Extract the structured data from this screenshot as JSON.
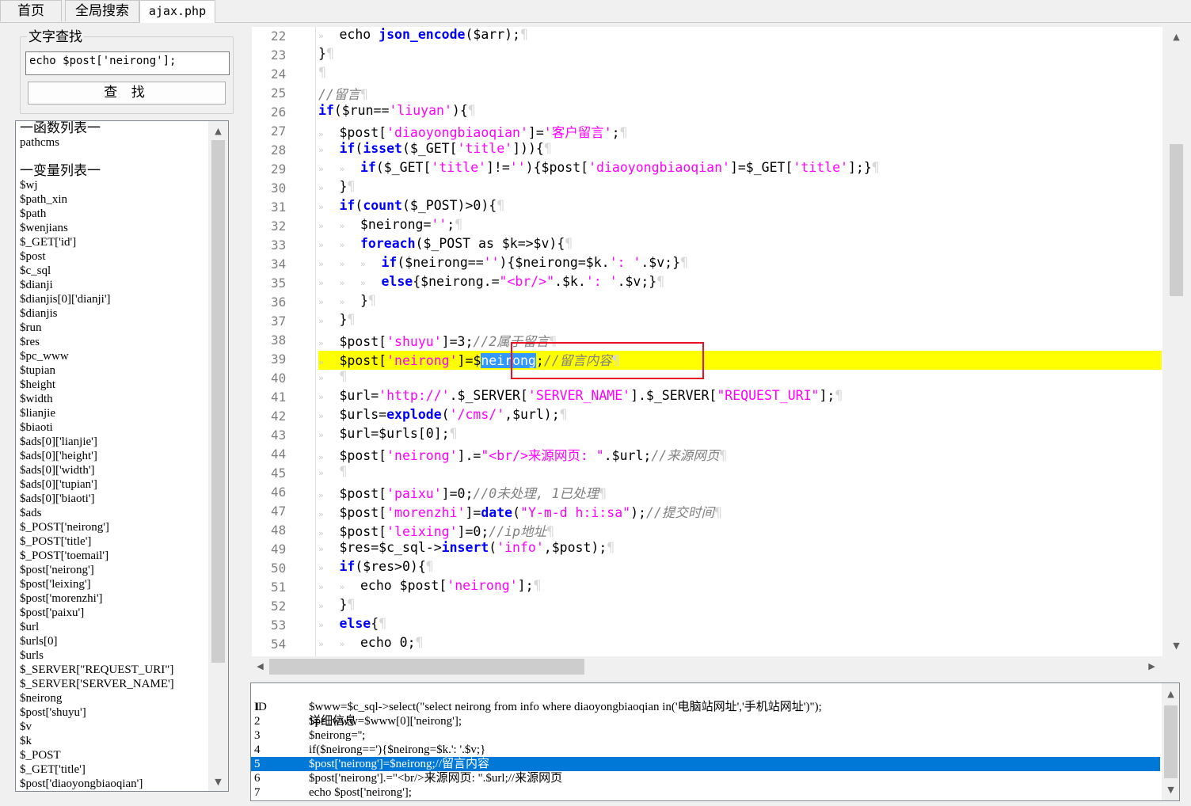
{
  "tabs": [
    "首页",
    "全局搜索",
    "ajax.php"
  ],
  "search": {
    "legend": "文字查找",
    "value": "echo $post['neirong'];",
    "button": "查 找"
  },
  "symbols": {
    "functions_header": "一函数列表一",
    "functions": [
      "pathcms"
    ],
    "variables_header": "一变量列表一",
    "variables": [
      "$wj",
      "$path_xin",
      "$path",
      "$wenjians",
      "$_GET['id']",
      "$post",
      "$c_sql",
      "$dianji",
      "$dianjis[0]['dianji']",
      "$dianjis",
      "$run",
      "$res",
      "$pc_www",
      "$tupian",
      "$height",
      "$width",
      "$lianjie",
      "$biaoti",
      "$ads[0]['lianjie']",
      "$ads[0]['height']",
      "$ads[0]['width']",
      "$ads[0]['tupian']",
      "$ads[0]['biaoti']",
      "$ads",
      "$_POST['neirong']",
      "$_POST['title']",
      "$_POST['toemail']",
      "$post['neirong']",
      "$post['leixing']",
      "$post['morenzhi']",
      "$post['paixu']",
      "$url",
      "$urls[0]",
      "$urls",
      "$_SERVER[\"REQUEST_URI\"]",
      "$_SERVER['SERVER_NAME']",
      "$neirong",
      "$post['shuyu']",
      "$v",
      "$k",
      "$_POST",
      "$_GET['title']",
      "$post['diaoyongbiaoqian']"
    ]
  },
  "code": {
    "line_numbers": [
      "22",
      "23",
      "24",
      "25",
      "26",
      "27",
      "28",
      "29",
      "30",
      "31",
      "32",
      "33",
      "34",
      "35",
      "36",
      "37",
      "38",
      "39",
      "40",
      "41",
      "42",
      "43",
      "44",
      "45",
      "46",
      "47",
      "48",
      "49",
      "50",
      "51",
      "52",
      "53",
      "54"
    ],
    "lines": {
      "l22_a": "echo ",
      "l22_b": "json_encode",
      "l22_c": "($arr);",
      "l23": "}",
      "l25": "//留言",
      "l26_a": "if",
      "l26_b": "($run==",
      "l26_c": "'liuyan'",
      "l26_d": "){",
      "l27_a": "$post[",
      "l27_b": "'diaoyongbiaoqian'",
      "l27_c": "]=",
      "l27_d": "'客户留言'",
      "l27_e": ";",
      "l28_a": "if",
      "l28_b": "(",
      "l28_c": "isset",
      "l28_d": "($_GET[",
      "l28_e": "'title'",
      "l28_f": "])){",
      "l29_a": "if",
      "l29_b": "($_GET[",
      "l29_c": "'title'",
      "l29_d": "]!=",
      "l29_e": "''",
      "l29_f": "){$post[",
      "l29_g": "'diaoyongbiaoqian'",
      "l29_h": "]=$_GET[",
      "l29_i": "'title'",
      "l29_j": "];}",
      "l30": "}",
      "l31_a": "if",
      "l31_b": "(",
      "l31_c": "count",
      "l31_d": "($_POST)>0){",
      "l32_a": "$neirong=",
      "l32_b": "''",
      "l32_c": ";",
      "l33_a": "foreach",
      "l33_b": "($_POST ",
      "l33_c": "as",
      "l33_d": " $k=>$v){",
      "l34_a": "if",
      "l34_b": "($neirong==",
      "l34_c": "''",
      "l34_d": "){$neirong=$k.",
      "l34_e": "': '",
      "l34_f": ".$v;}",
      "l35_a": "else",
      "l35_b": "{$neirong.=",
      "l35_c": "\"<br/>\"",
      "l35_d": ".$k.",
      "l35_e": "': '",
      "l35_f": ".$v;}",
      "l36": "}",
      "l37": "}",
      "l38_a": "$post[",
      "l38_b": "'shuyu'",
      "l38_c": "]=3;",
      "l38_d": "//2属于留言",
      "l39_a": "$post[",
      "l39_b": "'neirong'",
      "l39_c": "]=$",
      "l39_d": "neirong",
      "l39_e": ";",
      "l39_f": "//留言内容",
      "l41_a": "$url=",
      "l41_b": "'http://'",
      "l41_c": ".$_SERVER[",
      "l41_d": "'SERVER_NAME'",
      "l41_e": "].$_SERVER[",
      "l41_f": "\"REQUEST_URI\"",
      "l41_g": "];",
      "l42_a": "$urls=",
      "l42_b": "explode",
      "l42_c": "(",
      "l42_d": "'/cms/'",
      "l42_e": ",$url);",
      "l43": "$url=$urls[0];",
      "l44_a": "$post[",
      "l44_b": "'neirong'",
      "l44_c": "].=",
      "l44_d": "\"<br/>来源网页: \"",
      "l44_e": ".$url;",
      "l44_f": "//来源网页",
      "l46_a": "$post[",
      "l46_b": "'paixu'",
      "l46_c": "]=0;",
      "l46_d": "//0未处理, 1已处理",
      "l47_a": "$post[",
      "l47_b": "'morenzhi'",
      "l47_c": "]=",
      "l47_d": "date",
      "l47_e": "(",
      "l47_f": "\"Y-m-d h:i:sa\"",
      "l47_g": ");",
      "l47_h": "//提交时间",
      "l48_a": "$post[",
      "l48_b": "'leixing'",
      "l48_c": "]=0;",
      "l48_d": "//ip地址",
      "l49_a": "$res=$c_sql->",
      "l49_b": "insert",
      "l49_c": "(",
      "l49_d": "'info'",
      "l49_e": ",$post);",
      "l50_a": "if",
      "l50_b": "($res>0){",
      "l51_a": "echo ",
      "l51_b": "$post[",
      "l51_c": "'neirong'",
      "l51_d": "];",
      "l52": "}",
      "l53_a": "else",
      "l53_b": "{",
      "l54": "echo 0;"
    }
  },
  "details": {
    "header_id": "ID",
    "header_info": "详细信息",
    "rows": [
      {
        "id": "1",
        "text": "$www=$c_sql->select(\"select neirong from info where diaoyongbiaoqian in('电脑站网址','手机站网址')\");"
      },
      {
        "id": "2",
        "text": "$pc_www=$www[0]['neirong'];"
      },
      {
        "id": "3",
        "text": "$neirong='';"
      },
      {
        "id": "4",
        "text": "if($neirong=='){$neirong=$k.': '.$v;}"
      },
      {
        "id": "5",
        "text": "$post['neirong']=$neirong;//留言内容"
      },
      {
        "id": "6",
        "text": "$post['neirong'].=\"<br/>来源网页: \".$url;//来源网页"
      },
      {
        "id": "7",
        "text": "echo $post['neirong'];"
      }
    ]
  },
  "colors": {
    "keyword": "#0000ff",
    "string": "#ff00ff",
    "comment": "#808080",
    "highlight_line": "#ffff00",
    "selection": "#3399ff",
    "selected_row": "#0078d7",
    "annotation_box": "#e81123"
  }
}
